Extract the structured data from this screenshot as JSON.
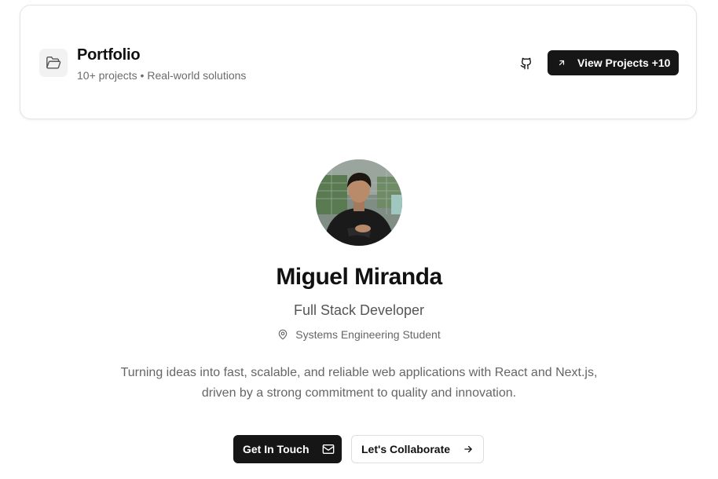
{
  "portfolio_card": {
    "icon": "folder-open-icon",
    "title": "Portfolio",
    "subtitle": "10+ projects • Real-world solutions",
    "github_icon": "github-icon",
    "view_button": {
      "icon": "arrow-up-right-icon",
      "label": "View Projects +10"
    }
  },
  "profile": {
    "avatar": "profile-photo",
    "name": "Miguel Miranda",
    "role": "Full Stack Developer",
    "location_icon": "map-pin-icon",
    "location": "Systems Engineering Student",
    "bio_line1": "Turning ideas into fast, scalable, and reliable web applications with React and Next.js,",
    "bio_line2": "driven by a strong commitment to quality and innovation."
  },
  "actions": {
    "primary": {
      "label": "Get In Touch",
      "icon": "mail-icon"
    },
    "secondary": {
      "label": "Let's Collaborate",
      "icon": "arrow-right-icon"
    }
  },
  "colors": {
    "primary_button_bg": "#161616",
    "text_dark": "#111111",
    "text_muted": "#666666",
    "card_border": "#e3e3e3"
  }
}
